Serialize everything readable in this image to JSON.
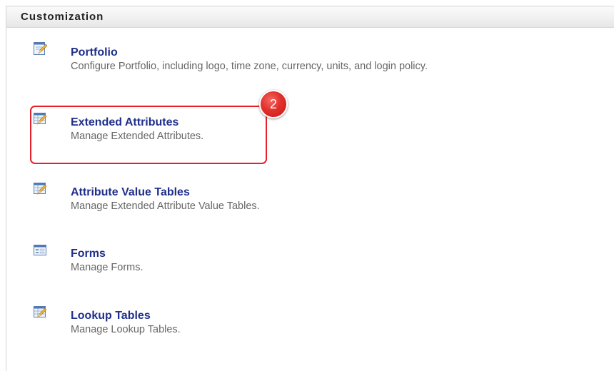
{
  "panel": {
    "title": "Customization"
  },
  "items": [
    {
      "title": "Portfolio",
      "description": "Configure Portfolio, including logo, time zone, currency, units, and login policy.",
      "icon": "edit-document-icon"
    },
    {
      "title": "Extended Attributes",
      "description": "Manage Extended Attributes.",
      "icon": "edit-table-icon"
    },
    {
      "title": "Attribute Value Tables",
      "description": "Manage Extended Attribute Value Tables.",
      "icon": "edit-table-icon"
    },
    {
      "title": "Forms",
      "description": "Manage Forms.",
      "icon": "form-icon"
    },
    {
      "title": "Lookup Tables",
      "description": "Manage Lookup Tables.",
      "icon": "edit-table-icon"
    }
  ],
  "annotation": {
    "step_number": "2",
    "color": "#e8202a"
  },
  "colors": {
    "link": "#1f2f8a",
    "description": "#666666"
  }
}
